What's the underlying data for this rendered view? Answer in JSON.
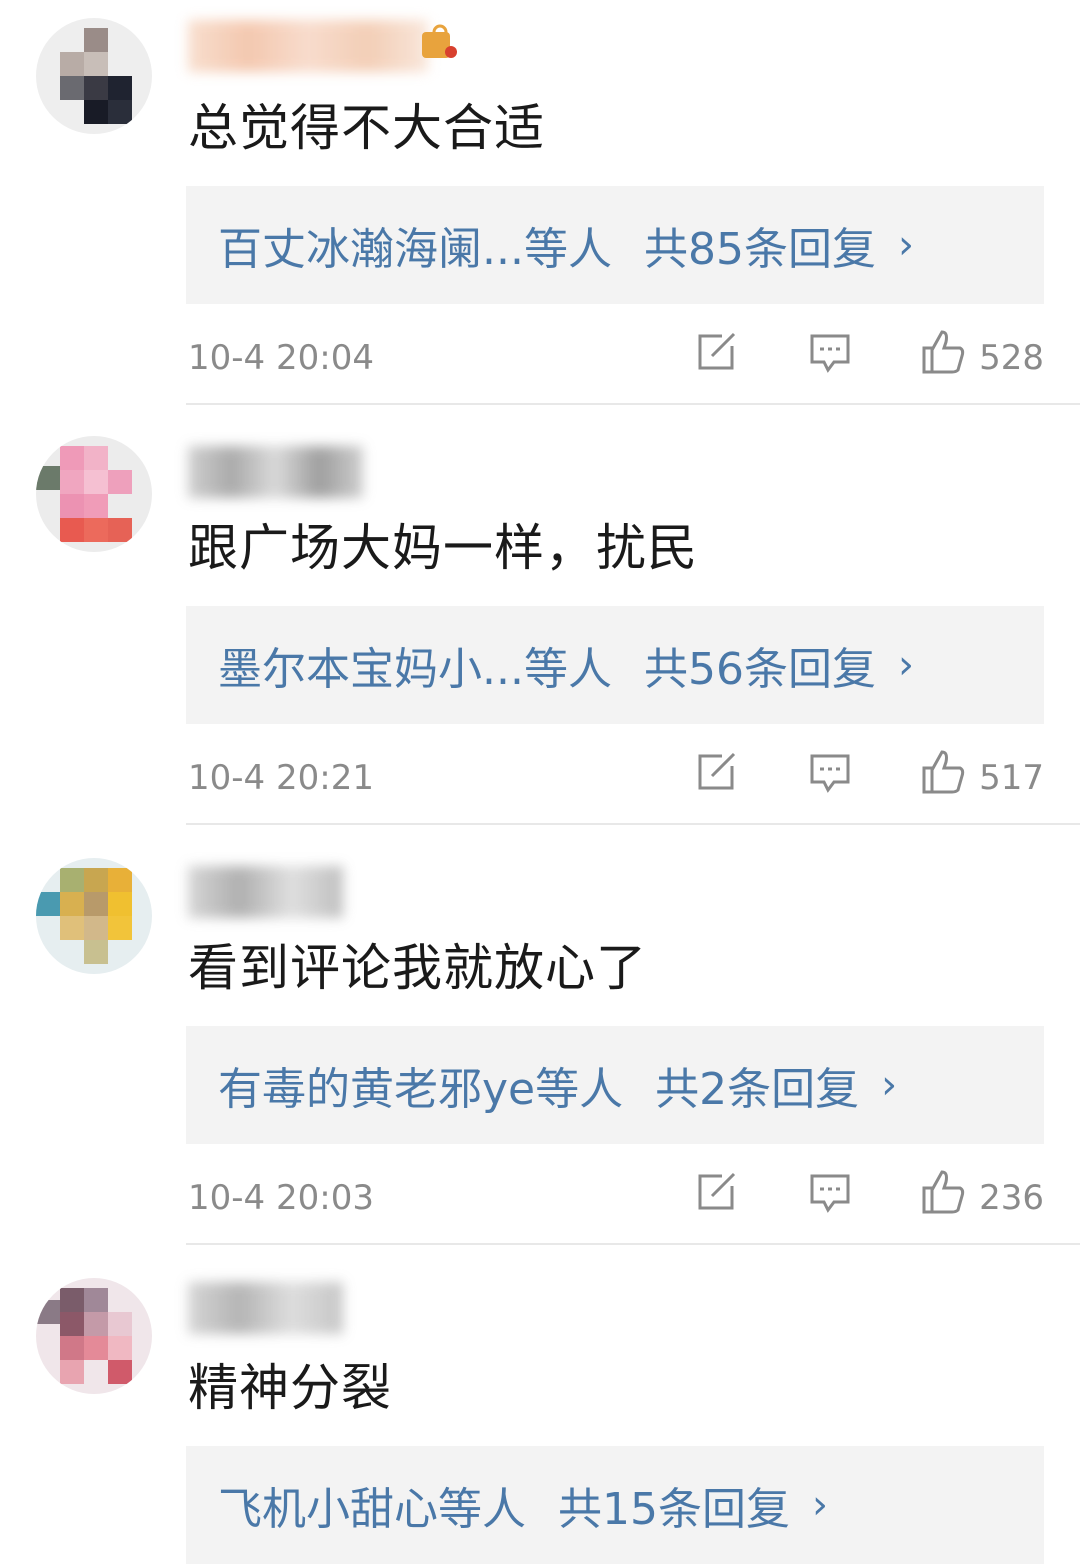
{
  "comments": [
    {
      "text": "总觉得不大合适",
      "reply_names": "百丈冰瀚海阑...等人",
      "reply_count": "共85条回复",
      "chevron": "›",
      "time": "10-4 20:04",
      "likes": "528"
    },
    {
      "text": "跟广场大妈一样，扰民",
      "reply_names": "墨尔本宝妈小...等人",
      "reply_count": "共56条回复",
      "chevron": "›",
      "time": "10-4 20:21",
      "likes": "517"
    },
    {
      "text": "看到评论我就放心了",
      "reply_names": "有毒的黄老邪ye等人",
      "reply_count": "共2条回复",
      "chevron": "›",
      "time": "10-4 20:03",
      "likes": "236"
    },
    {
      "text": "精神分裂",
      "reply_names": "飞机小甜心等人",
      "reply_count": "共15条回复",
      "chevron": "›",
      "time": "",
      "likes": ""
    }
  ],
  "icons": {
    "edit": "edit-icon",
    "comment": "comment-bubble-icon",
    "like": "thumbs-up-icon"
  },
  "colors": {
    "reply_link": "#4a78a8",
    "meta_text": "#8a8a8a",
    "reply_bg": "#f3f3f3"
  }
}
